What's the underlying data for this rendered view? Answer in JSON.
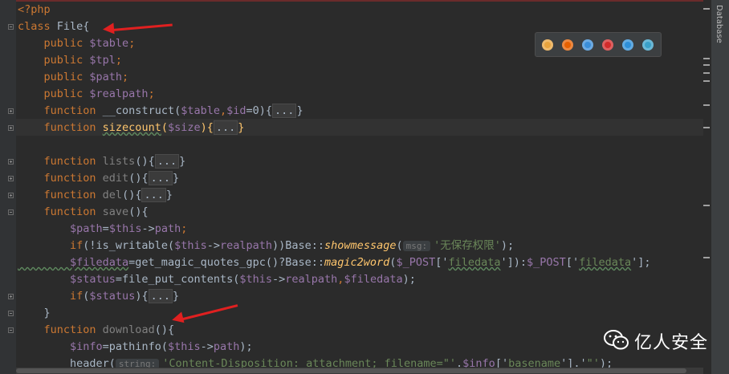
{
  "editor": {
    "lines": [
      {
        "id": "l1",
        "parts": [
          {
            "t": "<?php",
            "c": "kw"
          }
        ]
      },
      {
        "id": "l2",
        "parts": [
          {
            "t": "class ",
            "c": "kw"
          },
          {
            "t": "File{",
            "c": ""
          }
        ]
      },
      {
        "id": "l3",
        "parts": [
          {
            "t": "    public ",
            "c": "kw"
          },
          {
            "t": "$table",
            "c": "var"
          },
          {
            "t": ";",
            "c": "kw"
          }
        ]
      },
      {
        "id": "l4",
        "parts": [
          {
            "t": "    public ",
            "c": "kw"
          },
          {
            "t": "$tpl",
            "c": "var"
          },
          {
            "t": ";",
            "c": "kw"
          }
        ]
      },
      {
        "id": "l5",
        "parts": [
          {
            "t": "    public ",
            "c": "kw"
          },
          {
            "t": "$path",
            "c": "var"
          },
          {
            "t": ";",
            "c": "kw"
          }
        ]
      },
      {
        "id": "l6",
        "parts": [
          {
            "t": "    public ",
            "c": "kw"
          },
          {
            "t": "$realpath",
            "c": "var"
          },
          {
            "t": ";",
            "c": "kw"
          }
        ]
      },
      {
        "id": "l7",
        "parts": [
          {
            "t": "    function ",
            "c": "kw"
          },
          {
            "t": "__construct(",
            "c": ""
          },
          {
            "t": "$table",
            "c": "var"
          },
          {
            "t": ",",
            "c": "kw"
          },
          {
            "t": "$id",
            "c": "var"
          },
          {
            "t": "=0){",
            "c": ""
          },
          {
            "t": "...",
            "c": "fold-txt"
          },
          {
            "t": "}",
            "c": ""
          }
        ]
      },
      {
        "id": "l8",
        "parts": [
          {
            "t": "    function ",
            "c": "kw"
          },
          {
            "t": "sizecount",
            "c": "fn under"
          },
          {
            "t": "(",
            "c": "fn"
          },
          {
            "t": "$size",
            "c": "var"
          },
          {
            "t": "){",
            "c": "fn"
          },
          {
            "t": "...",
            "c": "fold-txt"
          },
          {
            "t": "}",
            "c": "fn"
          }
        ]
      },
      {
        "id": "l9",
        "parts": []
      },
      {
        "id": "l10",
        "parts": [
          {
            "t": "    function ",
            "c": "kw"
          },
          {
            "t": "lists",
            "c": "gray"
          },
          {
            "t": "(){",
            "c": ""
          },
          {
            "t": "...",
            "c": "fold-txt"
          },
          {
            "t": "}",
            "c": ""
          }
        ]
      },
      {
        "id": "l11",
        "parts": [
          {
            "t": "    function ",
            "c": "kw"
          },
          {
            "t": "edit",
            "c": "gray"
          },
          {
            "t": "(){",
            "c": ""
          },
          {
            "t": "...",
            "c": "fold-txt"
          },
          {
            "t": "}",
            "c": ""
          }
        ]
      },
      {
        "id": "l12",
        "parts": [
          {
            "t": "    function ",
            "c": "kw"
          },
          {
            "t": "del",
            "c": "gray"
          },
          {
            "t": "(){",
            "c": ""
          },
          {
            "t": "...",
            "c": "fold-txt"
          },
          {
            "t": "}",
            "c": ""
          }
        ]
      },
      {
        "id": "l13",
        "parts": [
          {
            "t": "    function ",
            "c": "kw"
          },
          {
            "t": "save",
            "c": "gray"
          },
          {
            "t": "(){",
            "c": ""
          }
        ]
      },
      {
        "id": "l14",
        "parts": [
          {
            "t": "        $path",
            "c": "var"
          },
          {
            "t": "=",
            "c": ""
          },
          {
            "t": "$this",
            "c": "var"
          },
          {
            "t": "->",
            "c": ""
          },
          {
            "t": "path",
            "c": "var"
          },
          {
            "t": ";",
            "c": "kw"
          }
        ]
      },
      {
        "id": "l15",
        "parts": [
          {
            "t": "        if",
            "c": "kw"
          },
          {
            "t": "(!is_writable(",
            "c": ""
          },
          {
            "t": "$this",
            "c": "var"
          },
          {
            "t": "->",
            "c": ""
          },
          {
            "t": "realpath",
            "c": "var"
          },
          {
            "t": "))Base::",
            "c": ""
          },
          {
            "t": "showmessage",
            "c": "it"
          },
          {
            "t": "(",
            "c": ""
          },
          {
            "t": "msg:",
            "c": "hint"
          },
          {
            "t": "'无保存权限'",
            "c": "str"
          },
          {
            "t": ");",
            "c": ""
          }
        ]
      },
      {
        "id": "l16",
        "parts": [
          {
            "t": "        $filedata",
            "c": "var under"
          },
          {
            "t": "=get_magic_quotes_gpc()?Base::",
            "c": ""
          },
          {
            "t": "magic2word",
            "c": "it"
          },
          {
            "t": "(",
            "c": ""
          },
          {
            "t": "$_POST",
            "c": "var"
          },
          {
            "t": "['",
            "c": ""
          },
          {
            "t": "filedata",
            "c": "str under"
          },
          {
            "t": "']):",
            "c": ""
          },
          {
            "t": "$_POST",
            "c": "var"
          },
          {
            "t": "['",
            "c": ""
          },
          {
            "t": "filedata",
            "c": "str under"
          },
          {
            "t": "'];",
            "c": ""
          }
        ]
      },
      {
        "id": "l17",
        "parts": [
          {
            "t": "        $status",
            "c": "var"
          },
          {
            "t": "=file_put_contents(",
            "c": ""
          },
          {
            "t": "$this",
            "c": "var"
          },
          {
            "t": "->",
            "c": ""
          },
          {
            "t": "realpath",
            "c": "var"
          },
          {
            "t": ",",
            "c": "kw"
          },
          {
            "t": "$filedata",
            "c": "var"
          },
          {
            "t": ");",
            "c": ""
          }
        ]
      },
      {
        "id": "l18",
        "parts": [
          {
            "t": "        if",
            "c": "kw"
          },
          {
            "t": "(",
            "c": ""
          },
          {
            "t": "$status",
            "c": "var"
          },
          {
            "t": "){",
            "c": ""
          },
          {
            "t": "...",
            "c": "fold-txt"
          },
          {
            "t": "}",
            "c": ""
          }
        ]
      },
      {
        "id": "l19",
        "parts": [
          {
            "t": "    }",
            "c": ""
          }
        ]
      },
      {
        "id": "l20",
        "parts": [
          {
            "t": "    function ",
            "c": "kw"
          },
          {
            "t": "download",
            "c": "gray"
          },
          {
            "t": "(){",
            "c": ""
          }
        ]
      },
      {
        "id": "l21",
        "parts": [
          {
            "t": "        $info",
            "c": "var"
          },
          {
            "t": "=pathinfo(",
            "c": ""
          },
          {
            "t": "$this",
            "c": "var"
          },
          {
            "t": "->",
            "c": ""
          },
          {
            "t": "path",
            "c": "var"
          },
          {
            "t": ");",
            "c": ""
          }
        ]
      },
      {
        "id": "l22",
        "parts": [
          {
            "t": "        header(",
            "c": ""
          },
          {
            "t": "string:",
            "c": "hint"
          },
          {
            "t": "'Content-Disposition: attachment; filename=\"'",
            "c": "str"
          },
          {
            "t": ".",
            "c": ""
          },
          {
            "t": "$info",
            "c": "var"
          },
          {
            "t": "['",
            "c": ""
          },
          {
            "t": "basename",
            "c": "str"
          },
          {
            "t": "'].'",
            "c": ""
          },
          {
            "t": "\"'",
            "c": "str"
          },
          {
            "t": ");",
            "c": ""
          }
        ]
      }
    ]
  },
  "side_panel": {
    "database_tab": "Database"
  },
  "browser_icons": [
    "chrome-icon",
    "firefox-icon",
    "safari-icon",
    "opera-icon",
    "ie-icon",
    "edge-icon"
  ],
  "colors": {
    "browser_icons": [
      "#e8a33d",
      "#e66000",
      "#3b8ed8",
      "#d22b2b",
      "#2e8fd8",
      "#3aa0c8"
    ]
  },
  "watermark": {
    "text": "亿人安全"
  }
}
